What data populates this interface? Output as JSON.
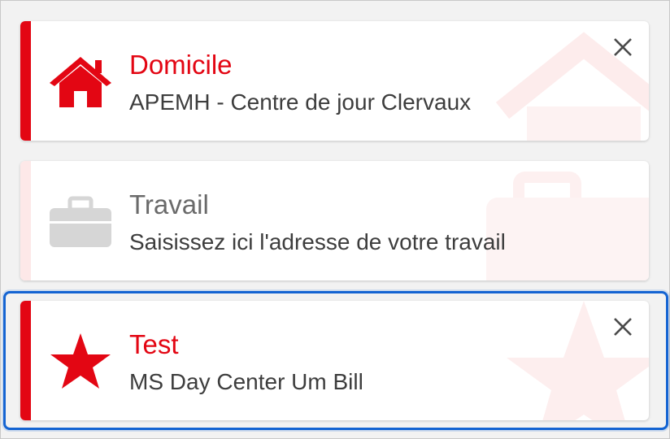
{
  "colors": {
    "accent": "#e30613",
    "accent_faded": "#fde8e8",
    "selection_ring": "#1464d2",
    "disabled_icon": "#d6d6d6",
    "watermark": "#fdeeee"
  },
  "places": [
    {
      "title": "Domicile",
      "address": "APEMH - Centre de jour Clervaux",
      "icon": "home-icon",
      "state": "active",
      "removable": true
    },
    {
      "title": "Travail",
      "address": "Saisissez ici l'adresse de votre travail",
      "icon": "briefcase-icon",
      "state": "empty",
      "removable": false
    },
    {
      "title": "Test",
      "address": "MS Day Center Um Bill",
      "icon": "star-icon",
      "state": "active",
      "removable": true,
      "selected": true
    }
  ]
}
